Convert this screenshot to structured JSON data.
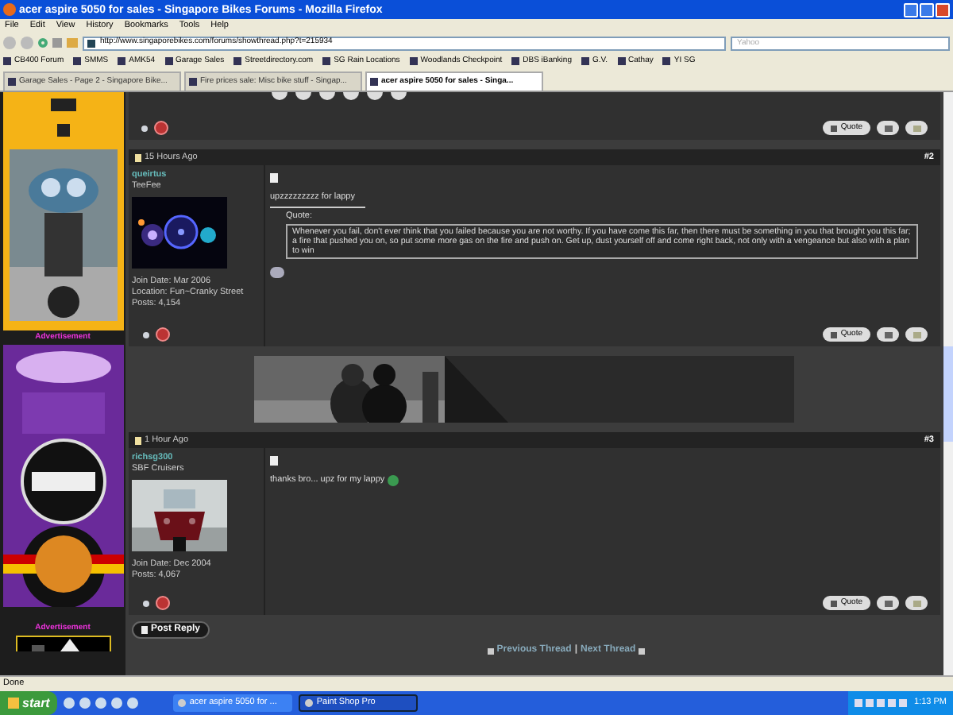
{
  "window": {
    "title": "acer aspire 5050 for sales - Singapore Bikes Forums - Mozilla Firefox"
  },
  "menu": [
    "File",
    "Edit",
    "View",
    "History",
    "Bookmarks",
    "Tools",
    "Help"
  ],
  "address_bar": {
    "url": "http://www.singaporebikes.com/forums/showthread.php?t=215934"
  },
  "search": {
    "placeholder": "Yahoo"
  },
  "bookmarks": [
    "CB400 Forum",
    "SMMS",
    "AMK54",
    "Garage Sales",
    "Streetdirectory.com",
    "SG Rain Locations",
    "Woodlands Checkpoint",
    "DBS iBanking",
    "G.V.",
    "Cathay",
    "YI SG"
  ],
  "tabs": [
    {
      "label": "Garage Sales - Page 2 - Singapore Bike...",
      "selected": false
    },
    {
      "label": "Fire prices sale: Misc bike stuff - Singap...",
      "selected": false
    },
    {
      "label": "acer aspire 5050 for sales - Singa...",
      "selected": true
    }
  ],
  "sidebar": {
    "ads": [
      "Advertisement",
      "Advertisement"
    ]
  },
  "previous_post": {
    "quote_button": "Quote"
  },
  "posts": [
    {
      "time": "15 Hours Ago",
      "number": "#2",
      "username": "queirtus",
      "user_title": "TeeFee",
      "join_date": "Join Date: Mar 2006",
      "location": "Location: Fun~Cranky Street",
      "post_count": "Posts: 4,154",
      "message": "upzzzzzzzzz for lappy",
      "quote_label": "Quote:",
      "quote": "Whenever you fail, don't ever think that you failed because you are not worthy. If you have come this far, then there must be something in you that brought you this far; a fire that pushed you on, so put some more gas on the fire and push on. Get up, dust yourself off and come right back, not only with a vengeance but also with a plan to win",
      "quote_button": "Quote"
    },
    {
      "time": "1 Hour Ago",
      "number": "#3",
      "username": "richsg300",
      "user_title": "SBF Cruisers",
      "join_date": "Join Date: Dec 2004",
      "post_count": "Posts: 4,067",
      "message": "thanks bro... upz for my lappy",
      "quote_button": "Quote"
    }
  ],
  "post_reply": "Post Reply",
  "thread_nav": {
    "previous": "Previous Thread",
    "separator": "|",
    "next": "Next Thread"
  },
  "status_bar": "Done",
  "taskbar": {
    "start": "start",
    "tasks": [
      {
        "label": "acer aspire 5050 for ...",
        "selected": false
      },
      {
        "label": "Paint Shop Pro",
        "selected": true
      }
    ],
    "clock": "1:13 PM"
  }
}
